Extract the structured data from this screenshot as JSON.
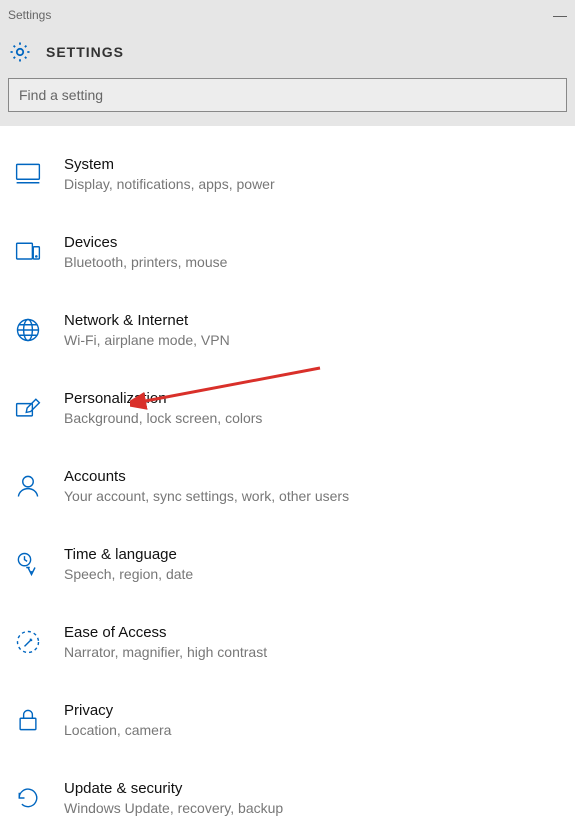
{
  "window": {
    "title": "Settings"
  },
  "header": {
    "label": "SETTINGS"
  },
  "search": {
    "placeholder": "Find a setting"
  },
  "items": [
    {
      "title": "System",
      "desc": "Display, notifications, apps, power"
    },
    {
      "title": "Devices",
      "desc": "Bluetooth, printers, mouse"
    },
    {
      "title": "Network & Internet",
      "desc": "Wi-Fi, airplane mode, VPN"
    },
    {
      "title": "Personalization",
      "desc": "Background, lock screen, colors"
    },
    {
      "title": "Accounts",
      "desc": "Your account, sync settings, work, other users"
    },
    {
      "title": "Time & language",
      "desc": "Speech, region, date"
    },
    {
      "title": "Ease of Access",
      "desc": "Narrator, magnifier, high contrast"
    },
    {
      "title": "Privacy",
      "desc": "Location, camera"
    },
    {
      "title": "Update & security",
      "desc": "Windows Update, recovery, backup"
    }
  ]
}
